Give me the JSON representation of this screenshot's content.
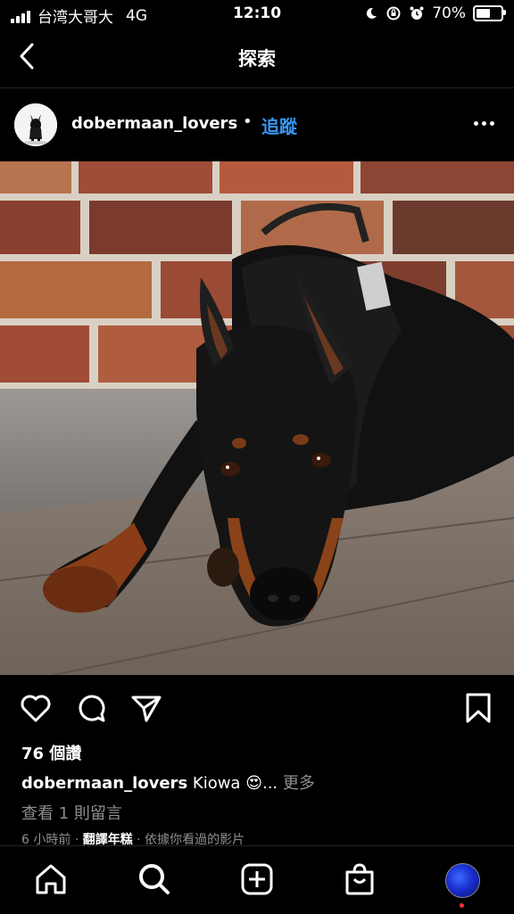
{
  "status_bar": {
    "carrier": "台湾大哥大",
    "network": "4G",
    "time": "12:10",
    "battery": "70%",
    "battery_level": 0.7
  },
  "nav": {
    "title": "探索",
    "back_icon": "chevron-left-icon"
  },
  "post": {
    "username": "dobermaan_lovers",
    "separator": "•",
    "follow_label": "追蹤",
    "likes": "76 個讚",
    "caption_user": "dobermaan_lovers",
    "caption_text": "Kiowa",
    "caption_emoji": "😍",
    "caption_ellipsis": "...",
    "caption_more": "更多",
    "view_comments": "查看 1 則留言",
    "time_ago": "6 小時前",
    "meta_sep": "·",
    "translate_label": "翻譯年糕",
    "reason": "依據你看過的影片"
  },
  "colors": {
    "background": "#000000",
    "link": "#3897f0",
    "secondary_text": "#8e8e8e",
    "notification": "#ff3040"
  },
  "tabs": [
    {
      "name": "home-icon"
    },
    {
      "name": "search-icon"
    },
    {
      "name": "create-icon"
    },
    {
      "name": "shop-icon"
    },
    {
      "name": "profile-avatar"
    }
  ]
}
